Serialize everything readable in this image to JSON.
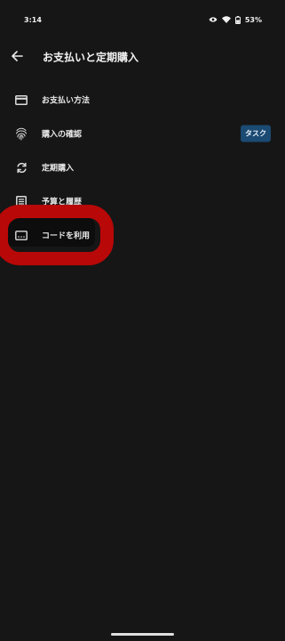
{
  "status_bar": {
    "time": "3:14",
    "battery": "53%",
    "icons": [
      "eye-icon",
      "wifi-icon",
      "battery-icon"
    ]
  },
  "app_bar": {
    "back_icon": "arrow-left-icon",
    "title": "お支払いと定期購入"
  },
  "menu": {
    "items": [
      {
        "label": "お支払い方法",
        "icon": "credit-card-icon"
      },
      {
        "label": "購入の確認",
        "icon": "fingerprint-icon",
        "badge": "タスク"
      },
      {
        "label": "定期購入",
        "icon": "refresh-icon"
      },
      {
        "label": "予算と履歴",
        "icon": "list-icon"
      },
      {
        "label": "コードを利用",
        "icon": "redeem-code-icon"
      }
    ]
  },
  "colors": {
    "background": "#161616",
    "badge": "#1b4a73",
    "highlight": "#b80808"
  }
}
